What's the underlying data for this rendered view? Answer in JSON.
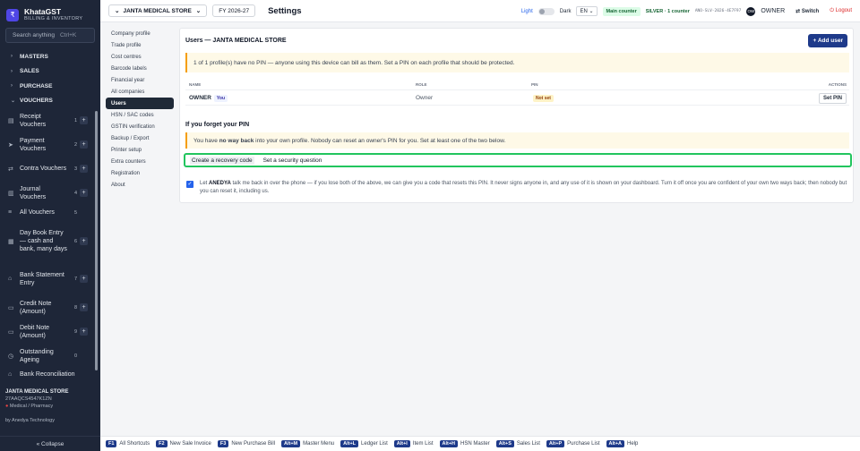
{
  "brand": {
    "name": "KhataGST",
    "subtitle": "BILLING & INVENTORY",
    "logo_glyph": "₹"
  },
  "search": {
    "placeholder": "Search anything",
    "shortcut": "Ctrl+K"
  },
  "nav": {
    "sections": [
      {
        "label": "MASTERS",
        "expanded": false
      },
      {
        "label": "SALES",
        "expanded": false
      },
      {
        "label": "PURCHASE",
        "expanded": false
      },
      {
        "label": "VOUCHERS",
        "expanded": true
      }
    ],
    "vouchers": [
      {
        "label": "Receipt Vouchers",
        "count": "1",
        "icon": "receipt-icon",
        "has_add": true
      },
      {
        "label": "Payment Vouchers",
        "count": "2",
        "icon": "send-icon",
        "has_add": true
      },
      {
        "label": "Contra Vouchers",
        "count": "3",
        "icon": "swap-icon",
        "has_add": true
      },
      {
        "label": "Journal Vouchers",
        "count": "4",
        "icon": "book-icon",
        "has_add": true
      },
      {
        "label": "All Vouchers",
        "count": "5",
        "icon": "list-icon",
        "has_add": false
      },
      {
        "label": "Day Book Entry — cash and bank, many days",
        "count": "6",
        "icon": "calendar-icon",
        "has_add": true
      },
      {
        "label": "Bank Statement Entry",
        "count": "7",
        "icon": "bank-icon",
        "has_add": true
      },
      {
        "label": "Credit Note (Amount)",
        "count": "8",
        "icon": "note-icon",
        "has_add": true
      },
      {
        "label": "Debit Note (Amount)",
        "count": "9",
        "icon": "note-icon",
        "has_add": true
      },
      {
        "label": "Outstanding Ageing",
        "count": "0",
        "icon": "clock-icon",
        "has_add": false
      },
      {
        "label": "Bank Reconciliation",
        "count": "",
        "icon": "bank-icon",
        "has_add": false
      }
    ]
  },
  "footer": {
    "store": "JANTA MEDICAL STORE",
    "gstin": "27AAQCS4547K1ZN",
    "category": "Medical / Pharmacy",
    "by": "by Anedya Technology",
    "collapse": "« Collapse"
  },
  "topbar": {
    "store": "JANTA MEDICAL STORE",
    "fy": "FY 2026-27",
    "title": "Settings",
    "light": "Light",
    "dark": "Dark",
    "lang": "EN",
    "main_counter": "Main counter",
    "license": "SILVER · 1 counter",
    "license_code": "ANO-SLV-2026-4E7F97",
    "owner_initials": "OW",
    "owner": "OWNER",
    "switch": "Switch",
    "logout": "Logout"
  },
  "settings_nav": [
    "Company profile",
    "Trade profile",
    "Cost centres",
    "Barcode labels",
    "Financial year",
    "All companies",
    "Users",
    "HSN / SAC codes",
    "GSTIN verification",
    "Backup / Export",
    "Printer setup",
    "Extra counters",
    "Registration",
    "About"
  ],
  "active_settings_item": "Users",
  "users": {
    "title": "Users — JANTA MEDICAL STORE",
    "add_button": "+ Add user",
    "warning": "1 of 1 profile(s) have no PIN — anyone using this device can bill as them. Set a PIN on each profile that should be protected.",
    "columns": [
      "NAME",
      "ROLE",
      "PIN",
      "ACTIONS"
    ],
    "rows": [
      {
        "name": "OWNER",
        "tag": "You",
        "role": "Owner",
        "pin": "Not set",
        "action": "Set PIN"
      }
    ]
  },
  "forgot": {
    "title": "If you forget your PIN",
    "warn_prefix": "You have ",
    "warn_bold": "no way back",
    "warn_suffix": " into your own profile. Nobody can reset an owner's PIN for you. Set at least one of the two below.",
    "option1": "Create a recovery code",
    "option2": "Set a security question",
    "consent_prefix": "Let ",
    "consent_name": "ANEDYA",
    "consent_text": " talk me back in over the phone — if you lose both of the above, we can give you a code that resets this PIN. It never signs anyone in, and any use of it is shown on your dashboard. Turn it off once you are confident of your own two ways back; then nobody but you can reset it, including us."
  },
  "shortcuts": [
    {
      "key": "F1",
      "label": "All Shortcuts"
    },
    {
      "key": "F2",
      "label": "New Sale Invoice"
    },
    {
      "key": "F3",
      "label": "New Purchase Bill"
    },
    {
      "key": "Alt+M",
      "label": "Master Menu"
    },
    {
      "key": "Alt+L",
      "label": "Ledger List"
    },
    {
      "key": "Alt+I",
      "label": "Item List"
    },
    {
      "key": "Alt+H",
      "label": "HSN Master"
    },
    {
      "key": "Alt+S",
      "label": "Sales List"
    },
    {
      "key": "Alt+P",
      "label": "Purchase List"
    },
    {
      "key": "Alt+A",
      "label": "Help"
    }
  ]
}
